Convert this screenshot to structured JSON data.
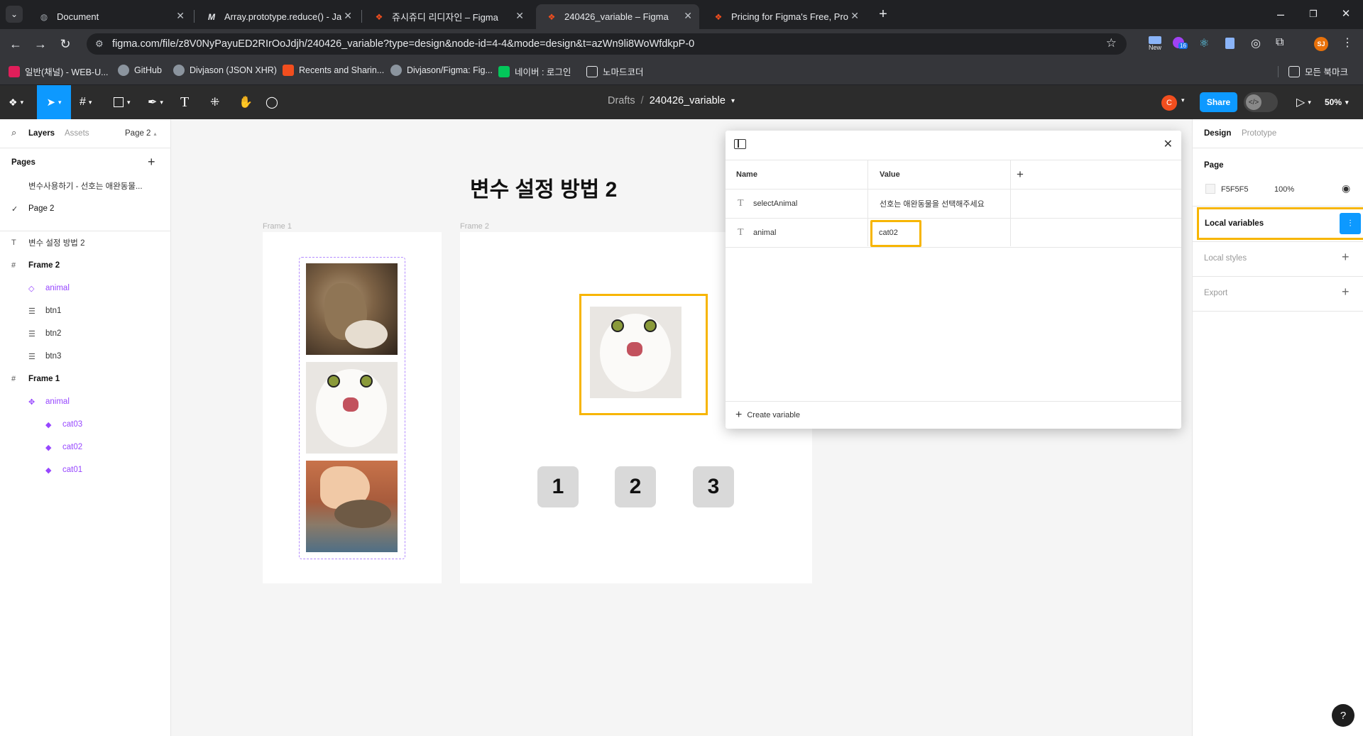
{
  "browser": {
    "tabs": [
      {
        "title": "Document",
        "icon": "globe-icon"
      },
      {
        "title": "Array.prototype.reduce() - Java",
        "icon": "mdn-icon"
      },
      {
        "title": "쥬시쥬디 리디자인 – Figma",
        "icon": "figma-icon"
      },
      {
        "title": "240426_variable – Figma",
        "icon": "figma-icon",
        "active": true
      },
      {
        "title": "Pricing for Figma's Free, Profes",
        "icon": "figma-icon"
      }
    ],
    "url": "figma.com/file/z8V0NyPayuED2RIrOoJdjh/240426_variable?type=design&node-id=4-4&mode=design&t=azWn9li8WoWfdkpP-0",
    "bookmarks": [
      {
        "label": "일반(채널) - WEB-U...",
        "color": "#e01e5a"
      },
      {
        "label": "GitHub",
        "color": "#8b949e"
      },
      {
        "label": "Divjason (JSON XHR)",
        "color": "#8b949e"
      },
      {
        "label": "Recents and Sharin...",
        "color": "#f24e1e"
      },
      {
        "label": "Divjason/Figma: Fig...",
        "color": "#8b949e"
      },
      {
        "label": "네이버 : 로그인",
        "color": "#03c75a"
      },
      {
        "label": "노마드코더",
        "color": "#e8eaed"
      }
    ],
    "all_bookmarks": "모든 북마크",
    "new_badge": "New",
    "ext_badge": "16",
    "profile": "SJ"
  },
  "toolbar": {
    "breadcrumb_root": "Drafts",
    "breadcrumb_sep": "/",
    "file_name": "240426_variable",
    "user_avatar": "C",
    "share_label": "Share",
    "zoom": "50%"
  },
  "left_panel": {
    "tab_layers": "Layers",
    "tab_assets": "Assets",
    "page_selector": "Page 2",
    "pages_title": "Pages",
    "pages": [
      {
        "label": "변수사용하기 - 선호는 애완동물...",
        "current": false
      },
      {
        "label": "Page 2",
        "current": true
      }
    ],
    "layers": [
      {
        "label": "변수 설정 방법 2",
        "icon": "text-icon",
        "indent": 0,
        "purple": false,
        "bold": false
      },
      {
        "label": "Frame 2",
        "icon": "frame-icon",
        "indent": 0,
        "purple": false,
        "bold": true
      },
      {
        "label": "animal",
        "icon": "instance-icon",
        "indent": 1,
        "purple": true,
        "bold": false
      },
      {
        "label": "btn1",
        "icon": "autolayout-icon",
        "indent": 1,
        "purple": false,
        "bold": false
      },
      {
        "label": "btn2",
        "icon": "autolayout-icon",
        "indent": 1,
        "purple": false,
        "bold": false
      },
      {
        "label": "btn3",
        "icon": "autolayout-icon",
        "indent": 1,
        "purple": false,
        "bold": false
      },
      {
        "label": "Frame 1",
        "icon": "frame-icon",
        "indent": 0,
        "purple": false,
        "bold": true
      },
      {
        "label": "animal",
        "icon": "component-set-icon",
        "indent": 1,
        "purple": true,
        "bold": false
      },
      {
        "label": "cat03",
        "icon": "component-icon",
        "indent": 2,
        "purple": true,
        "bold": false
      },
      {
        "label": "cat02",
        "icon": "component-icon",
        "indent": 2,
        "purple": true,
        "bold": false
      },
      {
        "label": "cat01",
        "icon": "component-icon",
        "indent": 2,
        "purple": true,
        "bold": false
      }
    ]
  },
  "canvas": {
    "heading": "변수 설정 방법 2",
    "frame1_label": "Frame 1",
    "frame2_label": "Frame 2",
    "buttons": [
      "1",
      "2",
      "3"
    ]
  },
  "variables_modal": {
    "col_name": "Name",
    "col_value": "Value",
    "rows": [
      {
        "name": "selectAnimal",
        "value": "선호는 애완동물을 선택해주세요"
      },
      {
        "name": "animal",
        "value": "cat02"
      }
    ],
    "create_label": "Create variable"
  },
  "right_panel": {
    "tab_design": "Design",
    "tab_prototype": "Prototype",
    "page_title": "Page",
    "page_color": "F5F5F5",
    "page_opacity": "100%",
    "local_variables": "Local variables",
    "local_styles": "Local styles",
    "export": "Export"
  },
  "help": "?",
  "colors": {
    "accent": "#0d99ff",
    "highlight": "#f7b500",
    "component": "#9747ff"
  }
}
